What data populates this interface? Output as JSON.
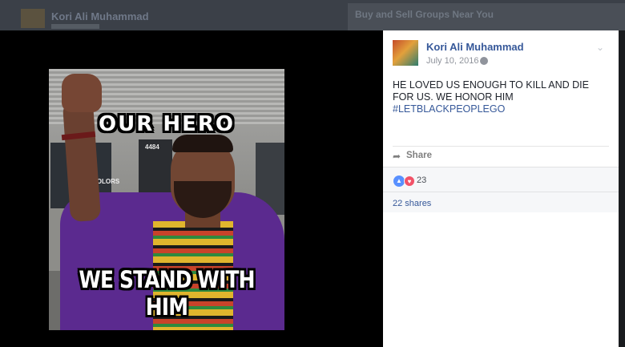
{
  "background": {
    "page_title": "Kori Ali Muhammad",
    "ad_heading": "Buy and Sell Groups Near You"
  },
  "photo": {
    "top_caption": "OUR HERO",
    "bottom_caption": "WE STAND WITH HIM",
    "door_number": "4484",
    "sign_text": "COLORS"
  },
  "post": {
    "author": "Kori Ali Muhammad",
    "date": "July 10, 2016 ·",
    "text": "HE LOVED US ENOUGH TO KILL AND DIE FOR US. WE HONOR HIM",
    "hashtag": "#LETBLACKPEOPLEGO",
    "share_label": "Share",
    "reaction_count": "23",
    "shares_label": "22 shares"
  },
  "icons": {
    "share": "share-arrow-icon",
    "like": "like-icon",
    "love": "love-icon",
    "privacy": "globe-icon",
    "options": "chevron-down-icon"
  },
  "colors": {
    "link": "#365899",
    "like": "#5890ff",
    "love": "#f25268"
  }
}
